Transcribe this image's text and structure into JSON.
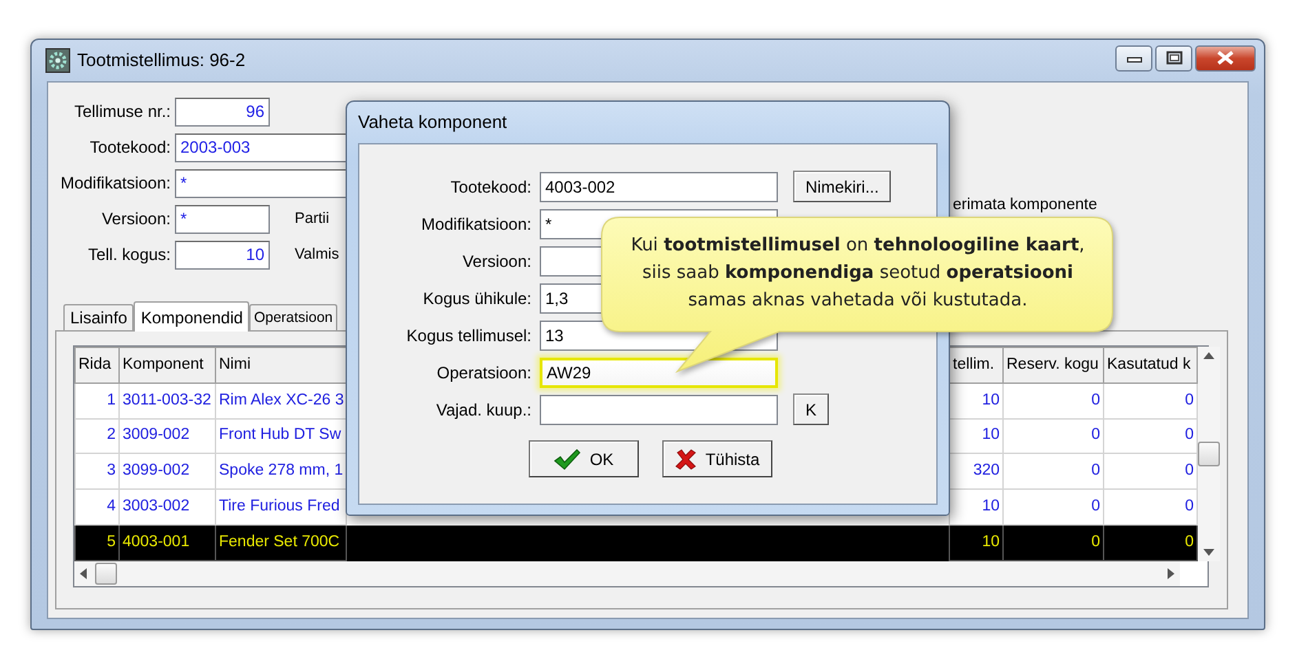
{
  "window": {
    "title": "Tootmistellimus: 96-2"
  },
  "order_form": {
    "fields": [
      {
        "label": "Tellimuse nr.:",
        "value": "96",
        "kind": "number"
      },
      {
        "label": "Tootekood:",
        "value": "2003-003",
        "kind": "code"
      },
      {
        "label": "Modifikatsioon:",
        "value": "*",
        "kind": "code"
      },
      {
        "label": "Versioon:",
        "value": "*",
        "kind": "short",
        "side_label": "Partii"
      },
      {
        "label": "Tell. kogus:",
        "value": "10",
        "kind": "number",
        "side_label": "Valmis"
      }
    ],
    "partial_label": "erimata komponente"
  },
  "tabs": [
    {
      "label": "Lisainfo",
      "selected": false
    },
    {
      "label": "Komponendid",
      "selected": true
    },
    {
      "label": "Operatsioon",
      "selected": false
    }
  ],
  "grid": {
    "columns": [
      {
        "label": "Rida",
        "kind": "number"
      },
      {
        "label": "Komponent",
        "kind": "text"
      },
      {
        "label": "Nimi",
        "kind": "text"
      },
      {
        "label": "tellim.",
        "kind": "number"
      },
      {
        "label": "Reserv. kogu",
        "kind": "number"
      },
      {
        "label": "Kasutatud k",
        "kind": "number"
      }
    ],
    "rows": [
      {
        "cells": [
          "1",
          "3011-003-32",
          "Rim Alex XC-26 3",
          "10",
          "0",
          "0"
        ],
        "selected": false
      },
      {
        "cells": [
          "2",
          "3009-002",
          "Front Hub DT Sw",
          "10",
          "0",
          "0"
        ],
        "selected": false
      },
      {
        "cells": [
          "3",
          "3099-002",
          "Spoke 278 mm, 1",
          "320",
          "0",
          "0"
        ],
        "selected": false
      },
      {
        "cells": [
          "4",
          "3003-002",
          "Tire Furious Fred",
          "10",
          "0",
          "0"
        ],
        "selected": false
      },
      {
        "cells": [
          "5",
          "4003-001",
          "Fender Set 700C",
          "10",
          "0",
          "0"
        ],
        "selected": true
      }
    ]
  },
  "dialog": {
    "title": "Vaheta komponent",
    "fields": [
      {
        "label": "Tootekood:",
        "value": "4003-002",
        "highlighted": false,
        "button": "Nimekiri..."
      },
      {
        "label": "Modifikatsioon:",
        "value": "*",
        "highlighted": false
      },
      {
        "label": "Versioon:",
        "highlighted": false
      },
      {
        "label": "Kogus ühikule:",
        "value": "1,3",
        "highlighted": false
      },
      {
        "label": "Kogus tellimusel:",
        "value": "13",
        "highlighted": false
      },
      {
        "label": "Operatsioon:",
        "value": "AW29",
        "highlighted": true
      },
      {
        "label": "Vajad. kuup.:",
        "highlighted": false,
        "button": "K"
      }
    ],
    "buttons": [
      {
        "label": "OK",
        "kind": "confirm"
      },
      {
        "label": "Tühista",
        "kind": "cancel"
      }
    ]
  },
  "callout": {
    "lines": [
      "Kui **tootmistellimusel** on **tehnoloogiline kaart**,",
      "siis saab **komponendiga** seotud **operatsiooni**",
      "samas aknas vahetada või kustutada."
    ]
  }
}
